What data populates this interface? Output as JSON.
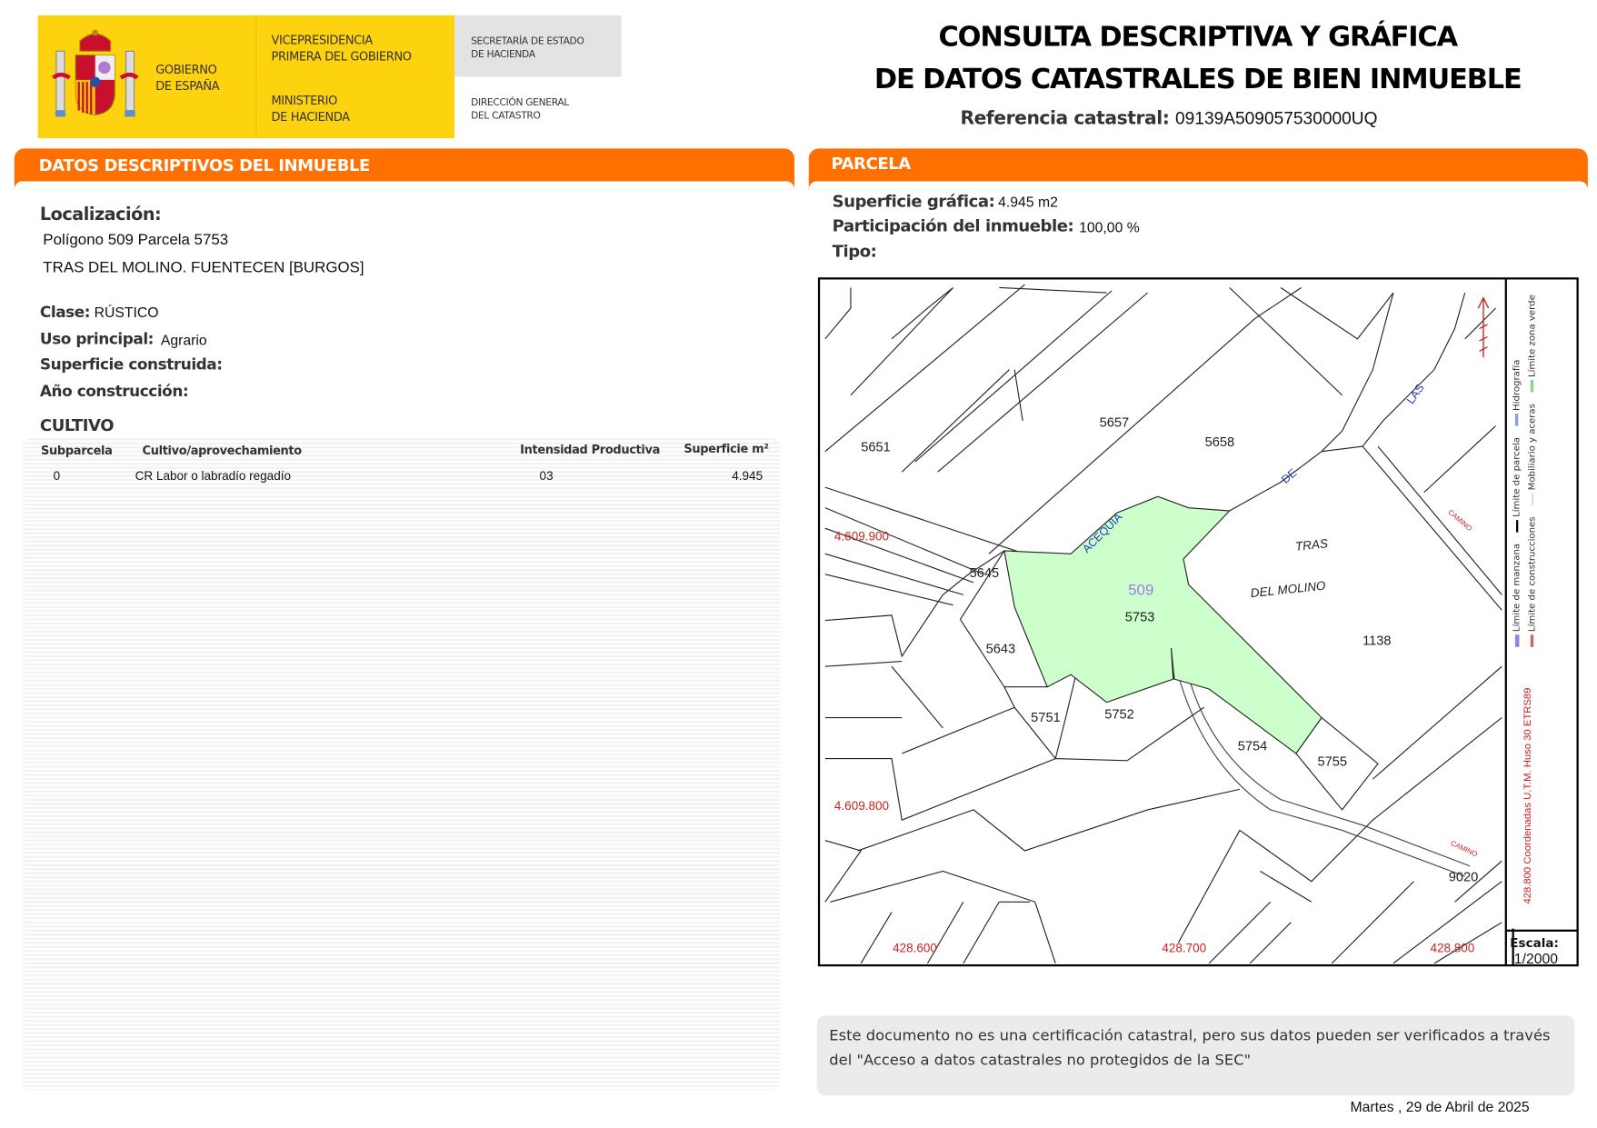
{
  "logo": {
    "gobierno": [
      "GOBIERNO",
      "DE ESPAÑA"
    ],
    "vicepresidencia": [
      "VICEPRESIDENCIA",
      "PRIMERA DEL GOBIERNO"
    ],
    "ministerio": [
      "MINISTERIO",
      "DE HACIENDA"
    ],
    "secretaria": [
      "SECRETARÍA DE ESTADO",
      "DE HACIENDA"
    ],
    "direccion": [
      "DIRECCIÓN GENERAL",
      "DEL CATASTRO"
    ]
  },
  "header": {
    "title_line1": "CONSULTA DESCRIPTIVA Y GRÁFICA",
    "title_line2": "DE DATOS CATASTRALES DE BIEN INMUEBLE",
    "ref_label": "Referencia catastral:",
    "ref_value": "09139A509057530000UQ"
  },
  "descriptivos": {
    "title": "DATOS DESCRIPTIVOS DEL INMUEBLE",
    "localizacion_label": "Localización:",
    "localizacion_line1": "Polígono 509 Parcela 5753",
    "localizacion_line2": "TRAS DEL MOLINO. FUENTECEN [BURGOS]",
    "clase_label": "Clase:",
    "clase_value": "RÚSTICO",
    "uso_label": "Uso principal:",
    "uso_value": "Agrario",
    "superficie_label": "Superficie construida:",
    "anio_label": "Año construcción:"
  },
  "cultivo": {
    "title": "CULTIVO",
    "columns": [
      "Subparcela",
      "Cultivo/aprovechamiento",
      "Intensidad Productiva",
      "Superficie m²"
    ],
    "rows": [
      {
        "subparcela": "0",
        "cultivo": "CR Labor o labradío regadío",
        "intensidad": "03",
        "superficie": "4.945"
      }
    ]
  },
  "parcela": {
    "title": "PARCELA",
    "superficie_label": "Superficie gráfica:",
    "superficie_value": "4.945 m2",
    "participacion_label": "Participación del inmueble:",
    "participacion_value": "100,00 %",
    "tipo_label": "Tipo:"
  },
  "map": {
    "parcels": {
      "p5651": "5651",
      "p5657": "5657",
      "p5658": "5658",
      "p5645": "5645",
      "poligono": "509",
      "p5753": "5753",
      "p5643": "5643",
      "p5751": "5751",
      "p5752": "5752",
      "p5754": "5754",
      "p5755": "5755",
      "p1138": "1138",
      "p9020": "9020"
    },
    "places": {
      "tras": "TRAS",
      "del_molino": "DEL MOLINO",
      "acequia": "ACEQUIA",
      "de": "DE",
      "las": "LAS",
      "camino1": "CAMINO",
      "camino2": "CAMINO"
    },
    "coords": {
      "y1": "4.609.900",
      "y2": "4.609.800",
      "x1": "428.600",
      "x2": "428.700",
      "x3": "428.800"
    },
    "colors": {
      "parcel_fill": "#ccffcc",
      "coord": "#cc2222",
      "label_blue": "#1f3fbf",
      "poligono": "#9c7cf0"
    },
    "legend": {
      "manzana": "Límite de manzana",
      "parcela": "Límite de parcela",
      "hidrografia": "Hidrografía",
      "construcciones": "Límite de construcciones",
      "mobiliario": "Mobiliario y aceras",
      "zona_verde": "Límite zona verde",
      "coords_note": "428.800 Coordenadas U.T.M. Huso 30 ETRS89"
    },
    "scale_label": "Escala:",
    "scale_value": "1/2000"
  },
  "footer": {
    "note": "Este documento no es una certificación catastral, pero sus datos pueden ser verificados a través del \"Acceso a datos catastrales no protegidos de la SEC\"",
    "date": "Martes , 29 de Abril de 2025"
  }
}
